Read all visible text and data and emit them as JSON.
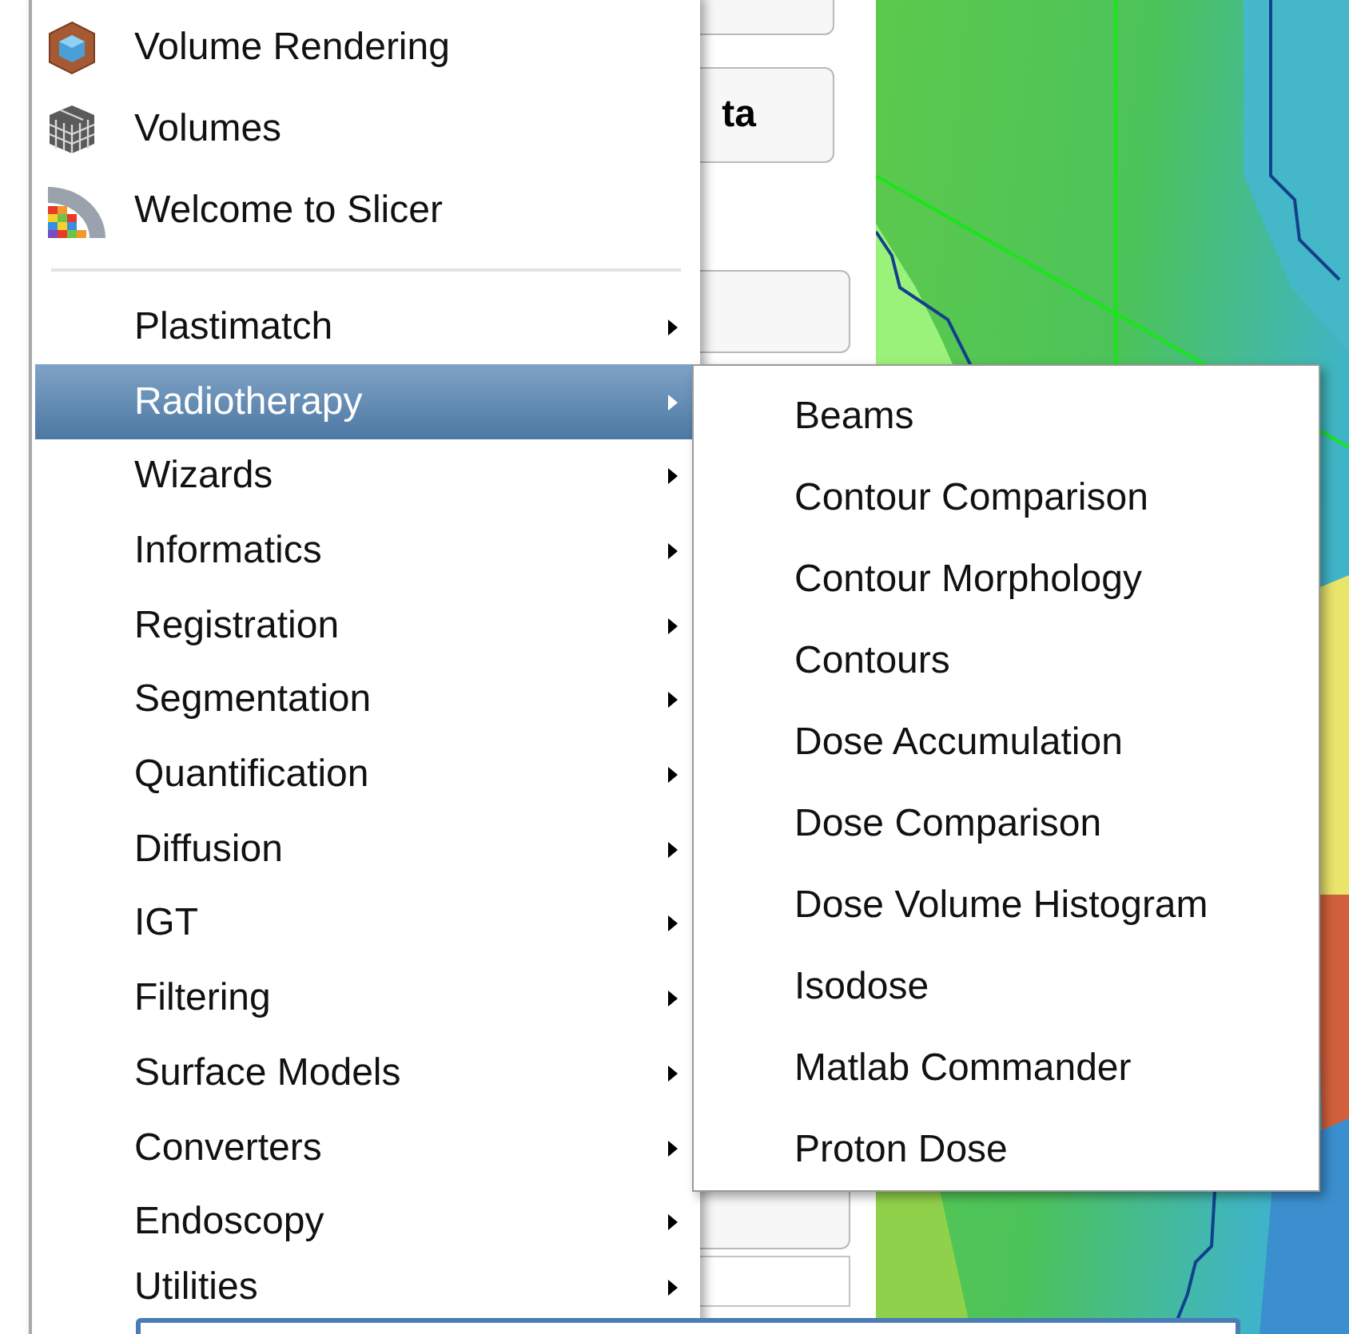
{
  "background_panel": {
    "button_text": "ta"
  },
  "menu": {
    "items": [
      {
        "kind": "module",
        "label": "Volume Rendering",
        "selected": false
      },
      {
        "kind": "module",
        "label": "Volumes",
        "selected": false
      },
      {
        "kind": "module",
        "label": "Welcome to Slicer",
        "selected": false
      },
      {
        "kind": "separator"
      },
      {
        "kind": "category",
        "label": "Plastimatch",
        "selected": false
      },
      {
        "kind": "category",
        "label": "Radiotherapy",
        "selected": true
      },
      {
        "kind": "category",
        "label": "Wizards",
        "selected": false
      },
      {
        "kind": "category",
        "label": "Informatics",
        "selected": false
      },
      {
        "kind": "category",
        "label": "Registration",
        "selected": false
      },
      {
        "kind": "category",
        "label": "Segmentation",
        "selected": false
      },
      {
        "kind": "category",
        "label": "Quantification",
        "selected": false
      },
      {
        "kind": "category",
        "label": "Diffusion",
        "selected": false
      },
      {
        "kind": "category",
        "label": "IGT",
        "selected": false
      },
      {
        "kind": "category",
        "label": "Filtering",
        "selected": false
      },
      {
        "kind": "category",
        "label": "Surface Models",
        "selected": false
      },
      {
        "kind": "category",
        "label": "Converters",
        "selected": false
      },
      {
        "kind": "category",
        "label": "Endoscopy",
        "selected": false
      },
      {
        "kind": "category",
        "label": "Utilities",
        "selected": false
      }
    ]
  },
  "submenu": {
    "items": [
      {
        "label": "Beams",
        "selected": false
      },
      {
        "label": "Contour Comparison",
        "selected": false
      },
      {
        "label": "Contour Morphology",
        "selected": false
      },
      {
        "label": "Contours",
        "selected": false
      },
      {
        "label": "Dose Accumulation",
        "selected": false
      },
      {
        "label": "Dose Comparison",
        "selected": false
      },
      {
        "label": "Dose Volume Histogram",
        "selected": false
      },
      {
        "label": "Isodose",
        "selected": false
      },
      {
        "label": "Matlab Commander",
        "selected": false
      },
      {
        "label": "Proton Dose",
        "selected": false
      }
    ]
  }
}
